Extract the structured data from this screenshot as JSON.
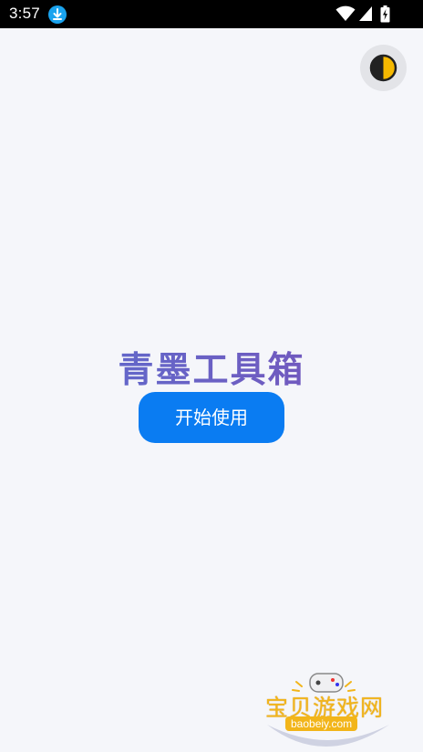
{
  "status_bar": {
    "time": "3:57"
  },
  "main": {
    "title": "青墨工具箱",
    "start_button_label": "开始使用"
  },
  "watermark": {
    "name": "宝贝游戏网",
    "url": "baobeiy.com"
  },
  "colors": {
    "primary_button": "#0a7cf2",
    "title_gradient_start": "#5a6fd0",
    "title_gradient_end": "#7a52b8",
    "background": "#f5f6fa",
    "toggle_background": "#e3e4e8",
    "toggle_accent": "#f5b800"
  },
  "icons": {
    "status_download": "download-icon",
    "status_wifi": "wifi-icon",
    "status_signal": "signal-icon",
    "status_battery": "battery-charging-icon",
    "theme_toggle": "contrast-icon"
  }
}
